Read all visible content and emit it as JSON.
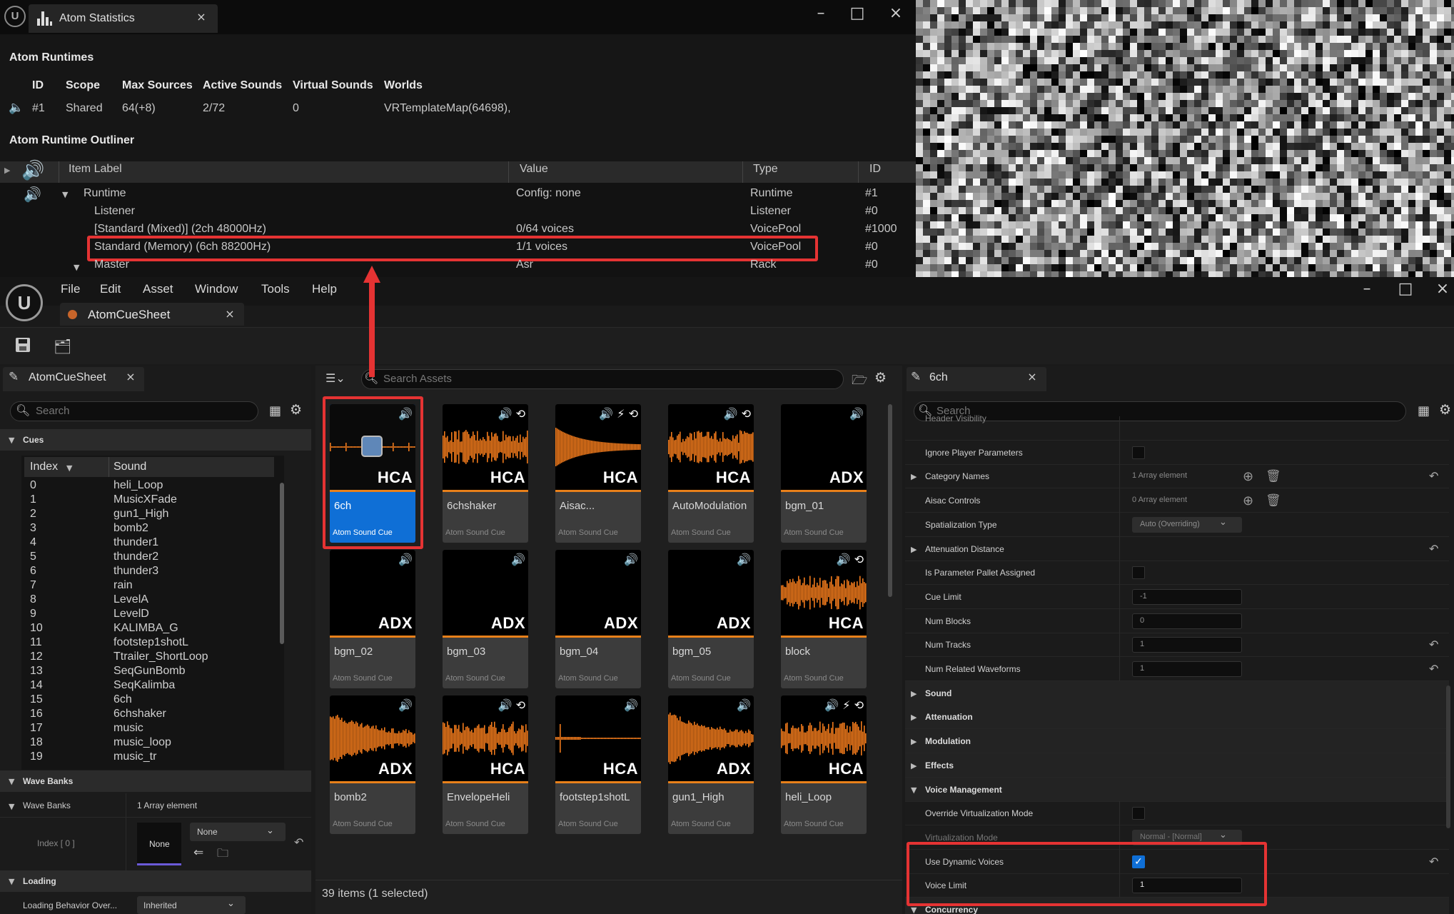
{
  "stats": {
    "tab_title": "Atom Statistics",
    "runtimes_heading": "Atom Runtimes",
    "columns": [
      "ID",
      "Scope",
      "Max Sources",
      "Active Sounds",
      "Virtual Sounds",
      "Worlds"
    ],
    "row": {
      "id": "#1",
      "scope": "Shared",
      "max_sources": "64(+8)",
      "active_sounds": "2/72",
      "virtual_sounds": "0",
      "worlds": "VRTemplateMap(64698),"
    },
    "outliner_heading": "Atom Runtime Outliner",
    "outliner_columns": [
      "Item Label",
      "Value",
      "Type",
      "ID"
    ],
    "outliner_rows": [
      {
        "label": "Runtime",
        "value": "Config: none",
        "type": "Runtime",
        "id": "#1"
      },
      {
        "label": "Listener",
        "value": "",
        "type": "Listener",
        "id": "#0"
      },
      {
        "label": "[Standard (Mixed)]  (2ch 48000Hz)",
        "value": "0/64 voices",
        "type": "VoicePool",
        "id": "#1000"
      },
      {
        "label": "Standard (Memory)  (6ch 88200Hz)",
        "value": "1/1 voices",
        "type": "VoicePool",
        "id": "#0"
      },
      {
        "label": "Master",
        "value": "Asr",
        "type": "Rack",
        "id": "#0"
      }
    ]
  },
  "menu": [
    "File",
    "Edit",
    "Asset",
    "Window",
    "Tools",
    "Help"
  ],
  "doc_tab": "AtomCueSheet",
  "left": {
    "tab": "AtomCueSheet",
    "search_placeholder": "Search",
    "cues_label": "Cues",
    "col_index": "Index",
    "col_sound": "Sound",
    "cues": [
      [
        "0",
        "heli_Loop"
      ],
      [
        "1",
        "MusicXFade"
      ],
      [
        "2",
        "gun1_High"
      ],
      [
        "3",
        "bomb2"
      ],
      [
        "4",
        "thunder1"
      ],
      [
        "5",
        "thunder2"
      ],
      [
        "6",
        "thunder3"
      ],
      [
        "7",
        "rain"
      ],
      [
        "8",
        "LevelA"
      ],
      [
        "9",
        "LevelD"
      ],
      [
        "10",
        "KALIMBA_G"
      ],
      [
        "11",
        "footstep1shotL"
      ],
      [
        "12",
        "Ttrailer_ShortLoop"
      ],
      [
        "13",
        "SeqGunBomb"
      ],
      [
        "14",
        "SeqKalimba"
      ],
      [
        "15",
        "6ch"
      ],
      [
        "16",
        "6chshaker"
      ],
      [
        "17",
        "music"
      ],
      [
        "18",
        "music_loop"
      ],
      [
        "19",
        "music_tr"
      ]
    ],
    "wave_banks_section": "Wave Banks",
    "wave_banks_label": "Wave Banks",
    "wave_banks_value": "1 Array element",
    "index_label": "Index [ 0 ]",
    "none_thumb": "None",
    "none_select": "None",
    "loading_section": "Loading",
    "loading_label": "Loading Behavior Over...",
    "loading_value": "Inherited"
  },
  "center": {
    "search_placeholder": "Search Assets",
    "status": "39 items (1 selected)",
    "tiles": [
      {
        "name": "6ch",
        "fmt": "HCA",
        "sub": "Atom Sound Cue",
        "icons": "🔊",
        "selected": true
      },
      {
        "name": "6chshaker",
        "fmt": "HCA",
        "sub": "Atom Sound Cue",
        "icons": "🔊 ⟲"
      },
      {
        "name": "Aisac...",
        "fmt": "HCA",
        "sub": "Atom Sound Cue",
        "icons": "🔊 ⚡ ⟲"
      },
      {
        "name": "AutoModulation",
        "fmt": "HCA",
        "sub": "Atom Sound Cue",
        "icons": "🔊 ⟲"
      },
      {
        "name": "bgm_01",
        "fmt": "ADX",
        "sub": "Atom Sound Cue",
        "icons": "🔊"
      },
      {
        "name": "bgm_02",
        "fmt": "ADX",
        "sub": "Atom Sound Cue",
        "icons": "🔊"
      },
      {
        "name": "bgm_03",
        "fmt": "ADX",
        "sub": "Atom Sound Cue",
        "icons": "🔊"
      },
      {
        "name": "bgm_04",
        "fmt": "ADX",
        "sub": "Atom Sound Cue",
        "icons": "🔊"
      },
      {
        "name": "bgm_05",
        "fmt": "ADX",
        "sub": "Atom Sound Cue",
        "icons": "🔊"
      },
      {
        "name": "block",
        "fmt": "HCA",
        "sub": "Atom Sound Cue",
        "icons": "🔊 ⟲"
      },
      {
        "name": "bomb2",
        "fmt": "ADX",
        "sub": "Atom Sound Cue",
        "icons": "🔊"
      },
      {
        "name": "EnvelopeHeli",
        "fmt": "HCA",
        "sub": "Atom Sound Cue",
        "icons": "🔊 ⟲"
      },
      {
        "name": "footstep1shotL",
        "fmt": "HCA",
        "sub": "Atom Sound Cue",
        "icons": "🔊"
      },
      {
        "name": "gun1_High",
        "fmt": "ADX",
        "sub": "Atom Sound Cue",
        "icons": "🔊"
      },
      {
        "name": "heli_Loop",
        "fmt": "HCA",
        "sub": "Atom Sound Cue",
        "icons": "🔊 ⚡ ⟲"
      }
    ]
  },
  "details": {
    "tab": "6ch",
    "search_placeholder": "Search",
    "rows": [
      {
        "label": "Header Visibility",
        "kind": "cut"
      },
      {
        "label": "Ignore Player Parameters",
        "kind": "check"
      },
      {
        "label": "Category Names",
        "kind": "array",
        "value": "1 Array element",
        "expand": true,
        "reset": true
      },
      {
        "label": "Aisac Controls",
        "kind": "array",
        "value": "0 Array element"
      },
      {
        "label": "Spatialization Type",
        "kind": "combo",
        "value": "Auto (Overriding)"
      },
      {
        "label": "Attenuation Distance",
        "kind": "none",
        "expand": true,
        "reset": true
      },
      {
        "label": "Is Parameter Pallet Assigned",
        "kind": "check"
      },
      {
        "label": "Cue Limit",
        "kind": "num",
        "value": "-1"
      },
      {
        "label": "Num Blocks",
        "kind": "num",
        "value": "0"
      },
      {
        "label": "Num Tracks",
        "kind": "num",
        "value": "1",
        "reset": true
      },
      {
        "label": "Num Related Waveforms",
        "kind": "num",
        "value": "1",
        "reset": true
      },
      {
        "label": "Sound",
        "kind": "section"
      },
      {
        "label": "Attenuation",
        "kind": "section"
      },
      {
        "label": "Modulation",
        "kind": "section"
      },
      {
        "label": "Effects",
        "kind": "section"
      },
      {
        "label": "Voice Management",
        "kind": "section-open"
      },
      {
        "label": "Override Virtualization Mode",
        "kind": "check"
      },
      {
        "label": "Virtualization Mode",
        "kind": "combo-dim",
        "value": "Normal - [Normal]"
      },
      {
        "label": "Use Dynamic Voices",
        "kind": "check-on",
        "reset": true
      },
      {
        "label": "Voice Limit",
        "kind": "num-bright",
        "value": "1"
      },
      {
        "label": "Concurrency",
        "kind": "section-open"
      }
    ]
  },
  "colors": {
    "accent": "#0f6fd6",
    "waveform": "#f07a1c",
    "highlight": "#e53333"
  }
}
